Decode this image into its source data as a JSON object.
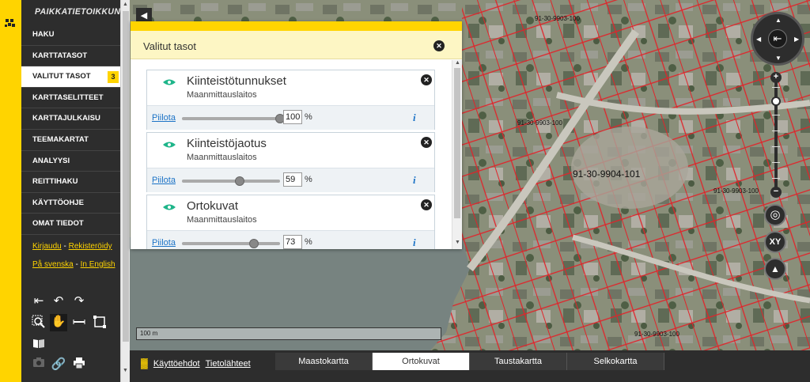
{
  "app": {
    "title": "PAIKKATIETOIKKUNA"
  },
  "sidebar": {
    "items": [
      {
        "label": "HAKU"
      },
      {
        "label": "KARTTATASOT"
      },
      {
        "label": "VALITUT TASOT",
        "badge": "3",
        "active": true
      },
      {
        "label": "KARTTASELITTEET"
      },
      {
        "label": "KARTTAJULKAISU"
      },
      {
        "label": "TEEMAKARTAT"
      },
      {
        "label": "ANALYYSI"
      },
      {
        "label": "REITTIHAKU"
      },
      {
        "label": "KÄYTTÖOHJE"
      },
      {
        "label": "OMAT TIEDOT"
      }
    ],
    "login_label": "Kirjaudu",
    "register_label": "Rekisteröidy",
    "swedish_label": "På svenska",
    "english_label": "In English",
    "separator": "-"
  },
  "tools": {
    "row1": [
      "undo-all-icon",
      "undo-icon",
      "redo-icon"
    ],
    "row2": [
      "zoom-box-icon",
      "pan-hand-icon",
      "measure-line-icon",
      "measure-area-icon"
    ],
    "row3": [
      "map-book-icon"
    ],
    "row4": [
      "camera-icon",
      "link-icon",
      "print-icon"
    ]
  },
  "panel": {
    "title": "Valitut tasot",
    "hide_label": "Piilota",
    "percent_sign": "%",
    "info_label": "i",
    "layers": [
      {
        "name": "Kiinteistötunnukset",
        "org": "Maanmittauslaitos",
        "opacity": "100"
      },
      {
        "name": "Kiinteistöjaotus",
        "org": "Maanmittauslaitos",
        "opacity": "59"
      },
      {
        "name": "Ortokuvat",
        "org": "Maanmittauslaitos",
        "opacity": "73"
      }
    ]
  },
  "map": {
    "scale_label": "100 m",
    "parcel_labels": [
      "91-30-9904-101",
      "91-30-9903-100",
      "91-30-9903-100",
      "91-30-9903-100",
      "91-30-9903-100"
    ],
    "xy_label": "XY"
  },
  "footer": {
    "terms_label": "Käyttöehdot",
    "sources_label": "Tietolähteet",
    "basemaps": [
      {
        "label": "Maastokartta",
        "active": false
      },
      {
        "label": "Ortokuvat",
        "active": true
      },
      {
        "label": "Taustakartta",
        "active": false
      },
      {
        "label": "Selkokartta",
        "active": false
      }
    ]
  },
  "colors": {
    "accent": "#ffd400",
    "sidebar": "#2d2d2d",
    "parcel": "#e0242a",
    "link": "#1c73c6"
  }
}
